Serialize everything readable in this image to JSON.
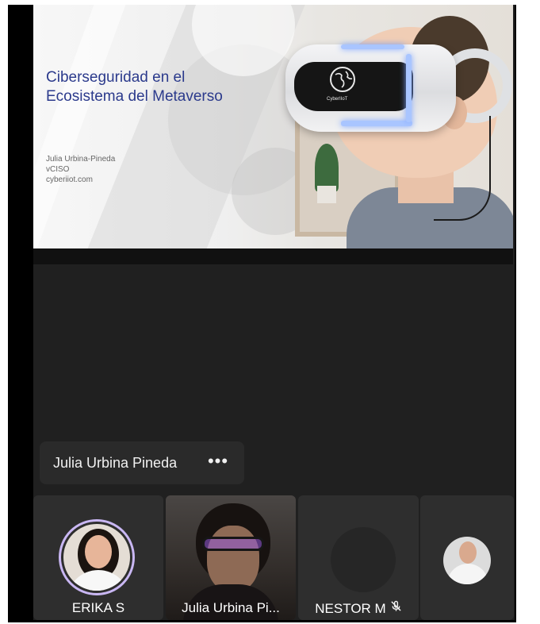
{
  "slide": {
    "title": "Ciberseguridad en el\n Ecosistema del Metaverso",
    "author": "Julia Urbina-Pineda",
    "role": "vCISO",
    "website": "cyberiiot.com",
    "headset_logo": "CyberIIoT"
  },
  "presenter": {
    "name": "Julia Urbina Pineda",
    "more_icon": "more-horizontal-icon"
  },
  "participants": [
    {
      "name": "ERIKA S",
      "kind": "avatar-photo",
      "speaking": true
    },
    {
      "name": "Julia Urbina Pi...",
      "kind": "video"
    },
    {
      "name": "NESTOR M",
      "kind": "placeholder",
      "muted": true,
      "muted_icon": "mic-off-icon"
    },
    {
      "name": "",
      "kind": "avatar-photo"
    }
  ],
  "colors": {
    "stage_bg": "#202020",
    "speaking_ring": "#c9b7f3",
    "slide_title": "#2b3a8c"
  }
}
